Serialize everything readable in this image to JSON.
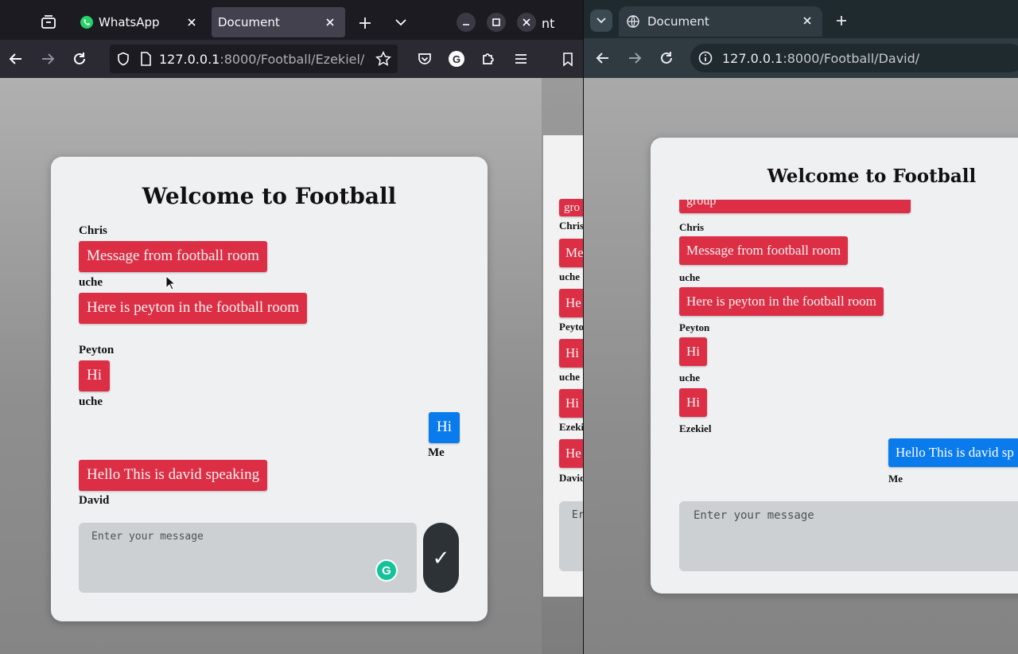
{
  "left_window": {
    "tabs": [
      {
        "label": "WhatsApp",
        "active": false
      },
      {
        "label": "Document",
        "active": true
      }
    ],
    "url_host": "127.0.0.1",
    "url_rest": ":8000/Football/Ezekiel/",
    "chat": {
      "title": "Welcome to Football",
      "messages": [
        {
          "sender": "Chris",
          "text": "Message from football room"
        },
        {
          "sender": "uche",
          "text": "Here is peyton in the football room"
        },
        {
          "sender": "Peyton",
          "text": "Hi"
        },
        {
          "sender": "uche",
          "text": ""
        },
        {
          "sender": "Me",
          "text": "Hi"
        },
        {
          "sender": "David",
          "text": "Hello This is david speaking"
        }
      ],
      "input_placeholder": "Enter your message",
      "send_label": "✓"
    }
  },
  "middle_window": {
    "tab_fragment": "nt",
    "visible_senders": [
      "Chris",
      "uche",
      "Peyto",
      "uche",
      "Ezeki",
      "David"
    ],
    "visible_bubbles": [
      "Me",
      "He",
      "Hi",
      "Hi",
      "He"
    ],
    "top_bubble_fragment": "gro",
    "input_fragment": "Er"
  },
  "right_window": {
    "tab_label": "Document",
    "url_host": "127.0.0.1",
    "url_rest": ":8000/Football/David/",
    "chat": {
      "title": "Welcome to Football",
      "top_bubble_fragment": "group",
      "messages": [
        {
          "sender": "Chris",
          "text": "Message from football room"
        },
        {
          "sender": "uche",
          "text": "Here is peyton in the football room"
        },
        {
          "sender": "Peyton",
          "text": "Hi"
        },
        {
          "sender": "uche",
          "text": "Hi"
        },
        {
          "sender": "Ezekiel",
          "text": ""
        },
        {
          "sender": "Me",
          "text": "Hello This is david sp"
        }
      ],
      "input_placeholder": "Enter your message"
    }
  },
  "colors": {
    "bubble_other": "#dc2f45",
    "bubble_me": "#0a7bec",
    "card_bg": "#eff0f2",
    "send_button": "#2c3236"
  }
}
